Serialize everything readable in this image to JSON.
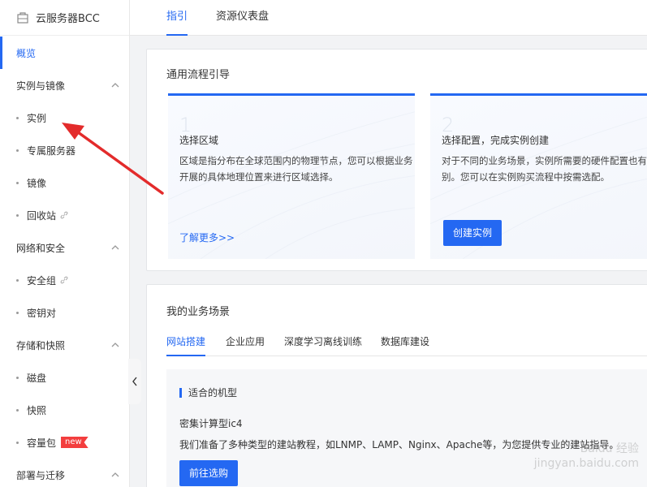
{
  "sidebar": {
    "title": "云服务器BCC",
    "overview": "概览",
    "groups": [
      {
        "label": "实例与镜像",
        "items": [
          {
            "label": "实例"
          },
          {
            "label": "专属服务器"
          },
          {
            "label": "镜像"
          },
          {
            "label": "回收站"
          }
        ]
      },
      {
        "label": "网络和安全",
        "items": [
          {
            "label": "安全组"
          },
          {
            "label": "密钥对"
          }
        ]
      },
      {
        "label": "存储和快照",
        "items": [
          {
            "label": "磁盘"
          },
          {
            "label": "快照"
          },
          {
            "label": "容量包",
            "badge": "new"
          }
        ]
      },
      {
        "label": "部署与迁移"
      }
    ]
  },
  "top_tabs": [
    "指引",
    "资源仪表盘"
  ],
  "guide_card": {
    "title": "通用流程引导",
    "steps": [
      {
        "num": "1",
        "title": "选择区域",
        "desc": "区域是指分布在全球范围内的物理节点，您可以根据业务开展的具体地理位置来进行区域选择。",
        "link": "了解更多>>"
      },
      {
        "num": "2",
        "title": "选择配置，完成实例创建",
        "desc": "对于不同的业务场景，实例所需要的硬件配置也有所区别。您可以在实例购买流程中按需选配。",
        "button": "创建实例"
      }
    ]
  },
  "scene_card": {
    "title": "我的业务场景",
    "tabs": [
      "网站搭建",
      "企业应用",
      "深度学习离线训练",
      "数据库建设"
    ],
    "panel": {
      "heading": "适合的机型",
      "model": "密集计算型ic4",
      "desc": "我们准备了多种类型的建站教程，如LNMP、LAMP、Nginx、Apache等，为您提供专业的建站指导。",
      "button": "前往选购"
    }
  },
  "watermark": {
    "line1": "Baidu 经验",
    "line2": "jingyan.baidu.com"
  },
  "colors": {
    "accent": "#2468f2",
    "annotation_arrow": "#e32b2b",
    "badge": "#f33e3e"
  }
}
